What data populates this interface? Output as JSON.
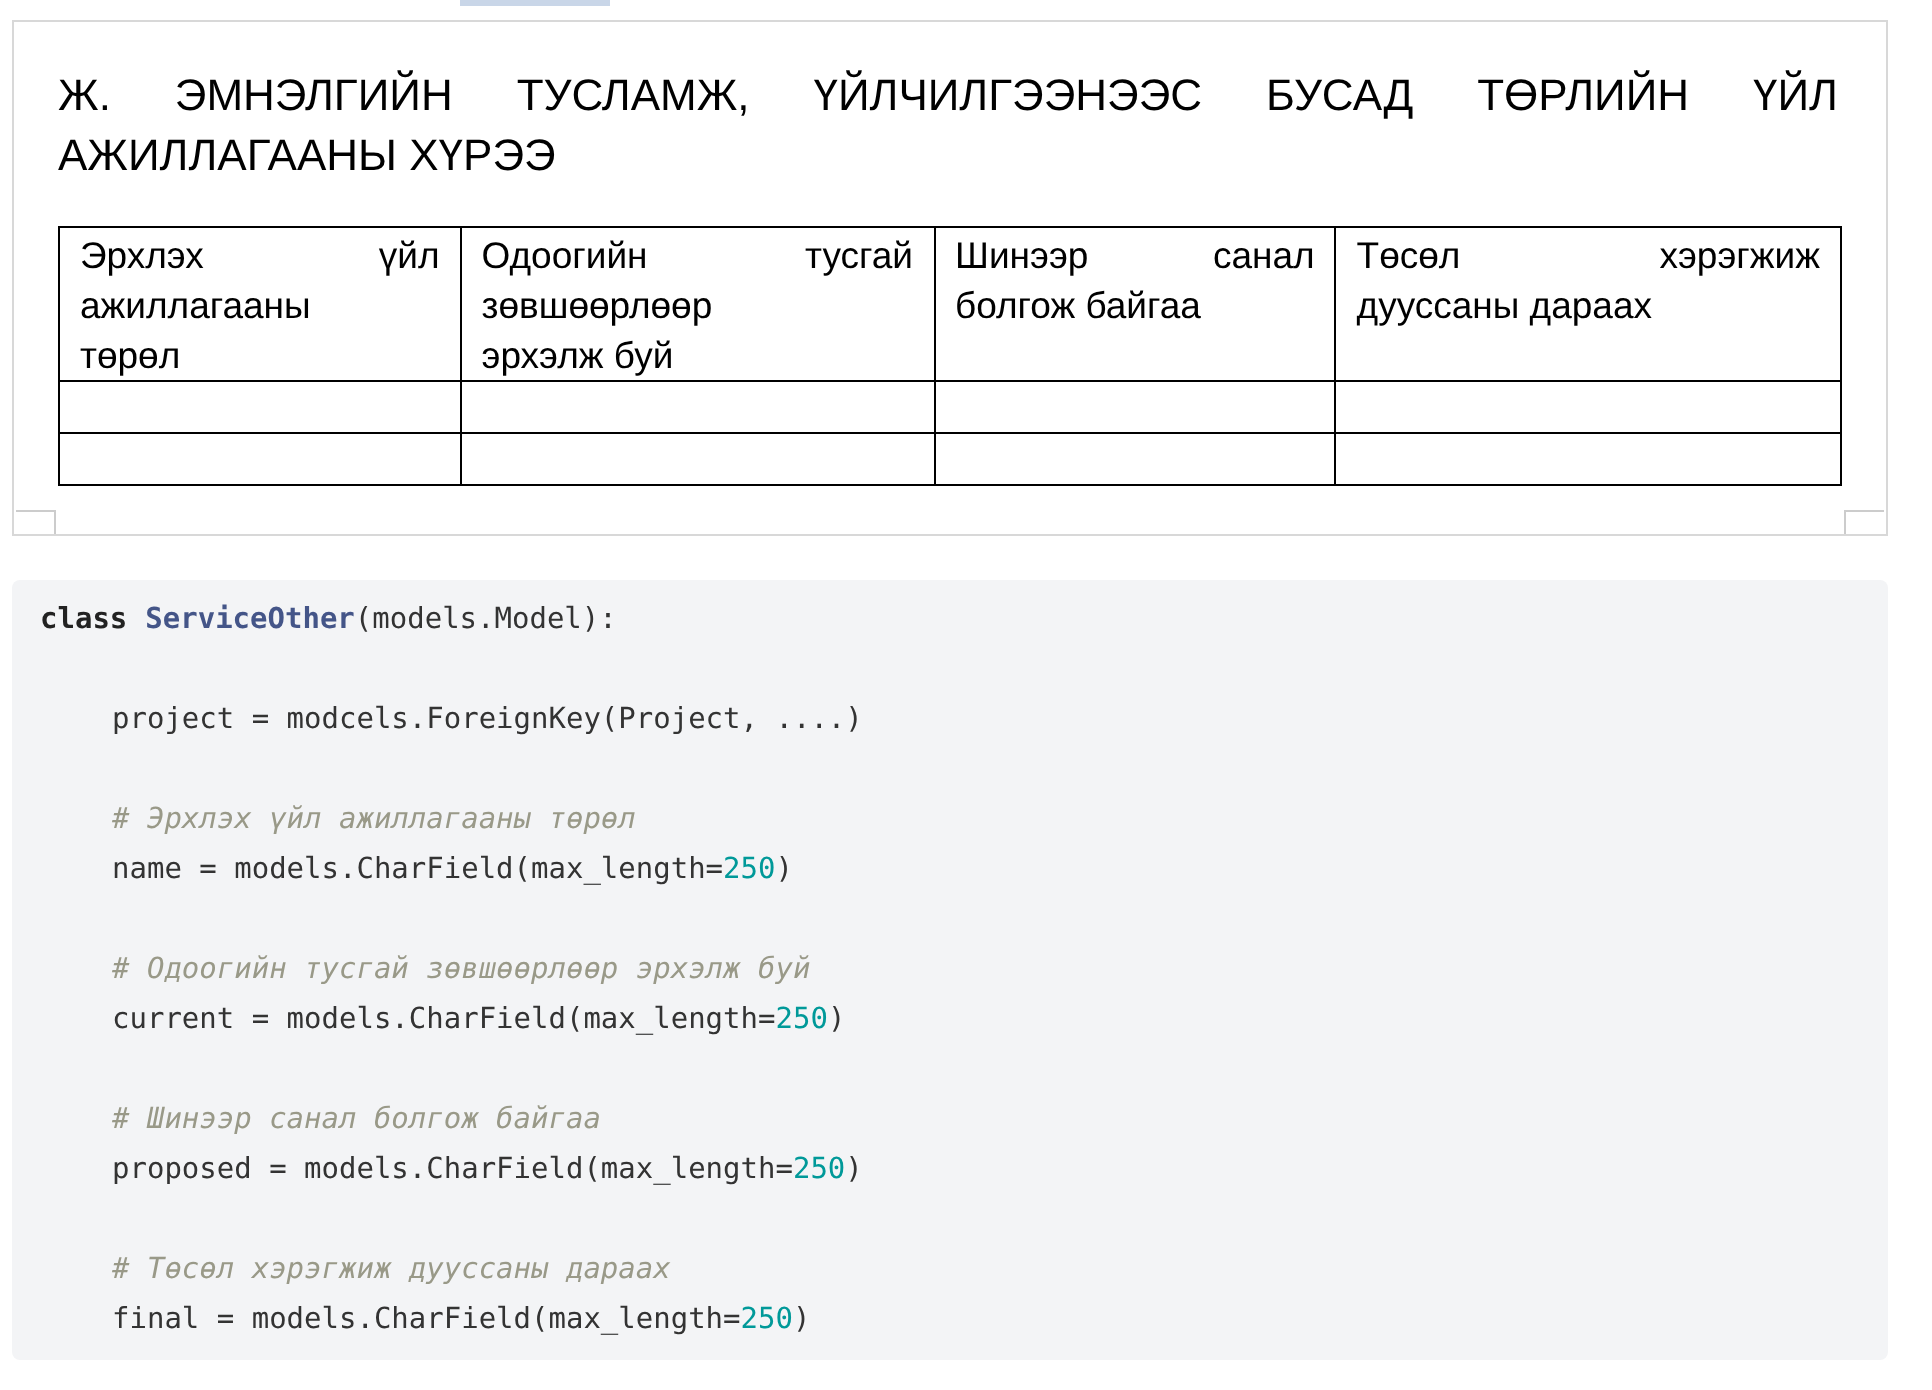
{
  "document": {
    "heading": "Ж. ЭМНЭЛГИЙН ТУСЛАМЖ, ҮЙЛЧИЛГЭЭНЭЭС БУСАД ТӨРЛИЙН ҮЙЛ АЖИЛЛАГААНЫ ХҮРЭЭ",
    "table": {
      "columns": [
        {
          "lines": [
            "Эрхлэх үйл",
            "ажиллагааны",
            "төрөл"
          ]
        },
        {
          "lines": [
            "Одоогийн тусгай",
            "зөвшөөрлөөр",
            "эрхэлж буй"
          ]
        },
        {
          "lines": [
            "Шинээр санал",
            "болгож байгаа"
          ]
        },
        {
          "lines": [
            "Төсөл хэрэгжиж",
            "дууссаны дараах"
          ]
        }
      ],
      "rows": [
        {
          "kind": "blank"
        },
        {
          "kind": "blank"
        }
      ]
    }
  },
  "code": {
    "lines": [
      {
        "kind": "header",
        "tokens": [
          {
            "kind": "keyword",
            "text": "class"
          },
          {
            "kind": "class",
            "text": "ServiceOther"
          },
          {
            "kind": "plain",
            "text": "(models.Model):"
          }
        ]
      },
      {
        "kind": "blank"
      },
      {
        "kind": "body",
        "tokens": [
          {
            "kind": "plain",
            "text": "project = modcels.ForeignKey(Project, ....)"
          }
        ]
      },
      {
        "kind": "blank"
      },
      {
        "kind": "body",
        "tokens": [
          {
            "kind": "comment",
            "text": "# Эрхлэх үйл ажиллагааны төрөл"
          }
        ]
      },
      {
        "kind": "body",
        "tokens": [
          {
            "kind": "plain",
            "text": "name = models.CharField(max_length="
          },
          {
            "kind": "number",
            "text": "250"
          },
          {
            "kind": "plain",
            "text": ")"
          }
        ]
      },
      {
        "kind": "blank"
      },
      {
        "kind": "body",
        "tokens": [
          {
            "kind": "comment",
            "text": "# Одоогийн тусгай зөвшөөрлөөр эрхэлж буй"
          }
        ]
      },
      {
        "kind": "body",
        "tokens": [
          {
            "kind": "plain",
            "text": "current = models.CharField(max_length="
          },
          {
            "kind": "number",
            "text": "250"
          },
          {
            "kind": "plain",
            "text": ")"
          }
        ]
      },
      {
        "kind": "blank"
      },
      {
        "kind": "body",
        "tokens": [
          {
            "kind": "comment",
            "text": "# Шинээр санал болгож байгаа"
          }
        ]
      },
      {
        "kind": "body",
        "tokens": [
          {
            "kind": "plain",
            "text": "proposed = models.CharField(max_length="
          },
          {
            "kind": "number",
            "text": "250"
          },
          {
            "kind": "plain",
            "text": ")"
          }
        ]
      },
      {
        "kind": "blank"
      },
      {
        "kind": "body",
        "tokens": [
          {
            "kind": "comment",
            "text": "# Төсөл хэрэгжиж дууссаны дараах"
          }
        ]
      },
      {
        "kind": "body",
        "tokens": [
          {
            "kind": "plain",
            "text": "final = models.CharField(max_length="
          },
          {
            "kind": "number",
            "text": "250"
          },
          {
            "kind": "plain",
            "text": ")"
          }
        ]
      }
    ]
  }
}
